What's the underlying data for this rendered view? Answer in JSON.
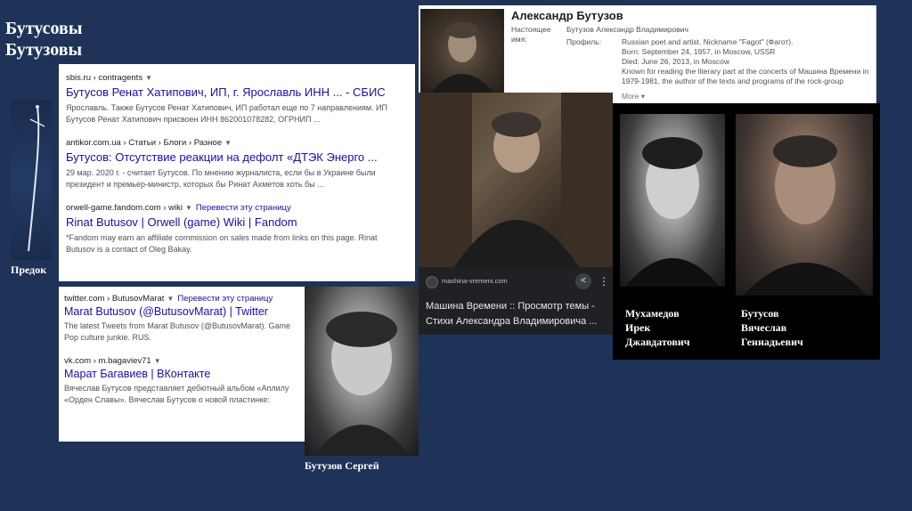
{
  "slide": {
    "title_line1": "Бутусовы",
    "title_line2": "Бутузовы"
  },
  "sword": {
    "label": "Предок"
  },
  "search_results_top": [
    {
      "url": "sbis.ru › contragents",
      "title": "Бутусов Ренат Хатипович, ИП, г. Ярославль ИНН ... - СБИС",
      "snippet_line1": "Ярославль. Также Бутусов Ренат Хатипович, ИП работал еще по 7 направлениям. ИП",
      "snippet_line2": "Бутусов Ренат Хатипович присвоен ИНН 862001078282, ОГРНИП ..."
    },
    {
      "url": "antikor.com.ua › Статьи › Блоги › Разное",
      "title": "Бутусов: Отсутствие реакции на дефолт «ДТЭК Энерго ...",
      "snippet_line1": "29 мар. 2020 г. - считает Бутусов. По мнению журналиста, если бы в Украине были",
      "snippet_line2": "президент и премьер-министр, которых бы Ринат Ахметов хоть бы ..."
    },
    {
      "url": "orwell-game.fandom.com › wiki",
      "translate": "Перевести эту страницу",
      "title": "Rinat Butusov | Orwell (game) Wiki | Fandom",
      "snippet_line1": "*Fandom may earn an affiliate commission on sales made from links on this page. Rinat",
      "snippet_line2": "Butusov is a contact of Oleg Bakay."
    }
  ],
  "search_results_bottom": [
    {
      "url": "twitter.com › ButusovMarat",
      "translate": "Перевести эту страницу",
      "title": "Marat Butusov (@ButusovMarat) | Twitter",
      "snippet_line1": "The latest Tweets from Marat Butusov (@ButusovMarat). Game",
      "snippet_line2": "Pop culture junkie. RUS."
    },
    {
      "url": "vk.com › m.bagaviev71",
      "title": "Марат Багавиев | ВКонтакте",
      "snippet_line1": "Вячеслав Бутусов представляет дебютный альбом «Аплилу",
      "snippet_line2": "«Орден Славы». Вячеслав Бутусов о новой пластинке:"
    }
  ],
  "knowledge_panel": {
    "name": "Александр Бутузов",
    "real_name_label": "Настоящее имя:",
    "real_name_value": "Бутузов Александр Владимирович",
    "profile_label": "Профиль:",
    "profile_lines": [
      "Russian poet and artist. Nickname \"Fagot\" (Фагот).",
      "Born: September 24, 1957, in Moscow, USSR",
      "Died: June 26, 2013, in Moscow",
      "Known for reading the literary part at the concerts of Машина Времени in",
      "1979-1981, the author of the texts and programs of the rock-group"
    ],
    "more": "More"
  },
  "image_result": {
    "site_url": "mashina-vremeni.com",
    "title": "Машина Времени :: Просмотр темы - Стихи Александра Владимировича ..."
  },
  "captions": {
    "sergey": "Бутузов Сергей",
    "mukhamedov": [
      "Мухамедов",
      "Ирек",
      "Джавдатович"
    ],
    "butusov_v": [
      "Бутусов",
      "Вячеслав",
      "Геннадьевич"
    ]
  }
}
